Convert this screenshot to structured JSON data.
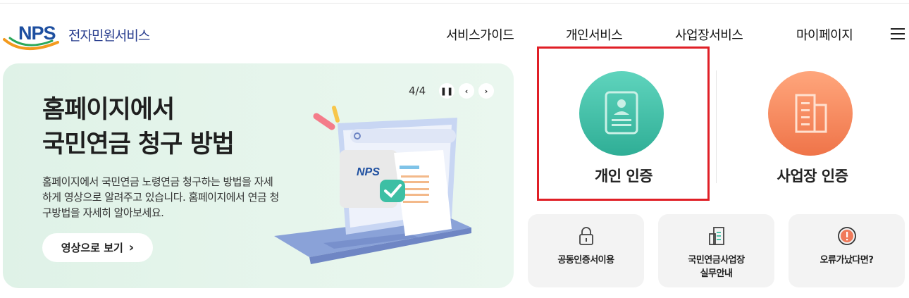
{
  "header": {
    "logo_text": "NPS",
    "logo_subtitle": "전자민원서비스",
    "nav": [
      "서비스가이드",
      "개인서비스",
      "사업장서비스",
      "마이페이지"
    ]
  },
  "banner": {
    "counter": "4/4",
    "title_line1": "홈페이지에서",
    "title_line2": "국민연금 청구 방법",
    "description": "홈페이지에서 국민연금 노령연금 청구하는 방법을 자세하게 영상으로 알려주고 있습니다. 홈페이지에서 연금 청구방법을 자세히 알아보세요.",
    "button_label": "영상으로 보기",
    "illustration_logo": "NPS"
  },
  "auth": {
    "personal_label": "개인 인증",
    "business_label": "사업장 인증"
  },
  "services": [
    {
      "label_line1": "공동인증서이용",
      "label_line2": ""
    },
    {
      "label_line1": "국민연금사업장",
      "label_line2": "실무안내"
    },
    {
      "label_line1": "오류가났다면?",
      "label_line2": ""
    }
  ],
  "colors": {
    "brand_blue": "#1e4fa0",
    "personal_circle": "#3dbfa4",
    "business_circle": "#f58a5e",
    "highlight": "#e01f26",
    "banner_bg": "#e2f4e9"
  },
  "icons": [
    "menu-icon",
    "pause-icon",
    "chevron-left-icon",
    "chevron-right-icon",
    "id-card-icon",
    "building-icon",
    "lock-icon",
    "document-icon",
    "alert-icon"
  ]
}
